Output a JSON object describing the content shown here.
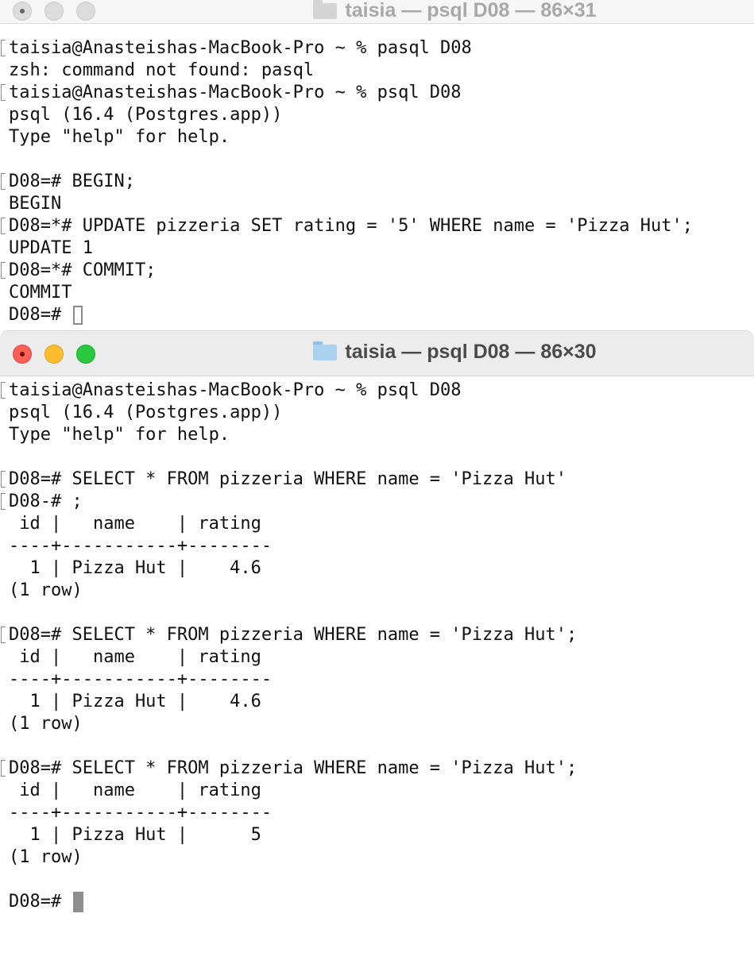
{
  "window_top": {
    "title": "taisia — psql D08 — 86×31",
    "lines": [
      {
        "text": "taisia@Anasteishas-MacBook-Pro ~ % pasql D08",
        "marked": true
      },
      {
        "text": "zsh: command not found: pasql",
        "marked": false
      },
      {
        "text": "taisia@Anasteishas-MacBook-Pro ~ % psql D08",
        "marked": true
      },
      {
        "text": "psql (16.4 (Postgres.app))",
        "marked": false
      },
      {
        "text": "Type \"help\" for help.",
        "marked": false
      },
      {
        "text": "",
        "marked": false
      },
      {
        "text": "D08=# BEGIN;",
        "marked": true
      },
      {
        "text": "BEGIN",
        "marked": false
      },
      {
        "text": "D08=*# UPDATE pizzeria SET rating = '5' WHERE name = 'Pizza Hut';",
        "marked": true
      },
      {
        "text": "UPDATE 1",
        "marked": false
      },
      {
        "text": "D08=*# COMMIT;",
        "marked": true
      },
      {
        "text": "COMMIT",
        "marked": false
      }
    ],
    "prompt": "D08=# "
  },
  "window_bottom": {
    "title": "taisia — psql D08 — 86×30",
    "lines": [
      {
        "text": "taisia@Anasteishas-MacBook-Pro ~ % psql D08",
        "marked": true
      },
      {
        "text": "psql (16.4 (Postgres.app))",
        "marked": false
      },
      {
        "text": "Type \"help\" for help.",
        "marked": false
      },
      {
        "text": "",
        "marked": false
      },
      {
        "text": "D08=# SELECT * FROM pizzeria WHERE name = 'Pizza Hut'",
        "marked": true
      },
      {
        "text": "D08-# ;",
        "marked": true
      },
      {
        "text": " id |   name    | rating",
        "marked": false
      },
      {
        "text": "----+-----------+--------",
        "marked": false
      },
      {
        "text": "  1 | Pizza Hut |    4.6",
        "marked": false
      },
      {
        "text": "(1 row)",
        "marked": false
      },
      {
        "text": "",
        "marked": false
      },
      {
        "text": "D08=# SELECT * FROM pizzeria WHERE name = 'Pizza Hut';",
        "marked": true
      },
      {
        "text": " id |   name    | rating",
        "marked": false
      },
      {
        "text": "----+-----------+--------",
        "marked": false
      },
      {
        "text": "  1 | Pizza Hut |    4.6",
        "marked": false
      },
      {
        "text": "(1 row)",
        "marked": false
      },
      {
        "text": "",
        "marked": false
      },
      {
        "text": "D08=# SELECT * FROM pizzeria WHERE name = 'Pizza Hut';",
        "marked": true
      },
      {
        "text": " id |   name    | rating",
        "marked": false
      },
      {
        "text": "----+-----------+--------",
        "marked": false
      },
      {
        "text": "  1 | Pizza Hut |      5",
        "marked": false
      },
      {
        "text": "(1 row)",
        "marked": false
      },
      {
        "text": "",
        "marked": false
      }
    ],
    "prompt": "D08=# "
  }
}
